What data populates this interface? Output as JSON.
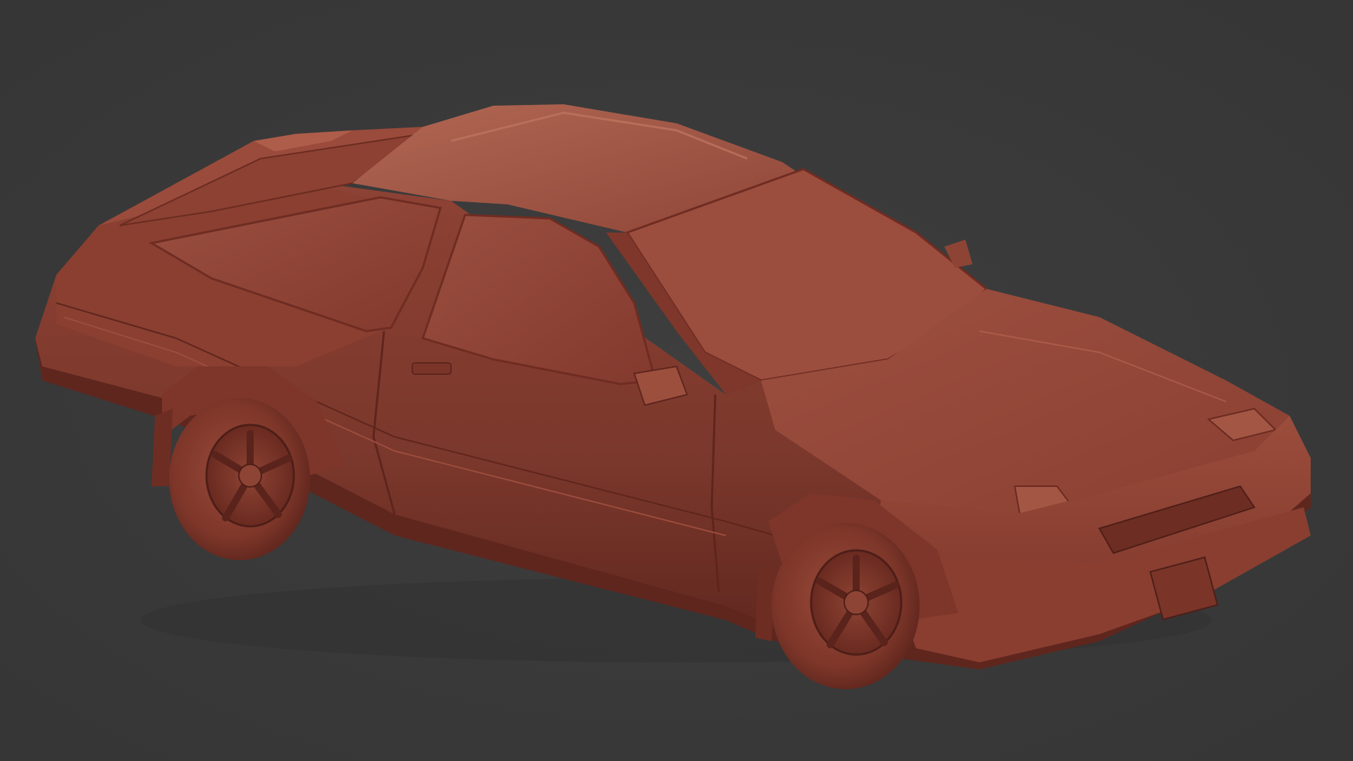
{
  "scene": {
    "subject": "3d-car-sculpt",
    "colors": {
      "background": "#3b3b3b",
      "clay_dark": "#6e2e24",
      "clay_mid": "#8e4436",
      "clay_light": "#a55b48",
      "clay_highlight": "#b86b55",
      "clay_shadow": "#4d1e18"
    }
  }
}
